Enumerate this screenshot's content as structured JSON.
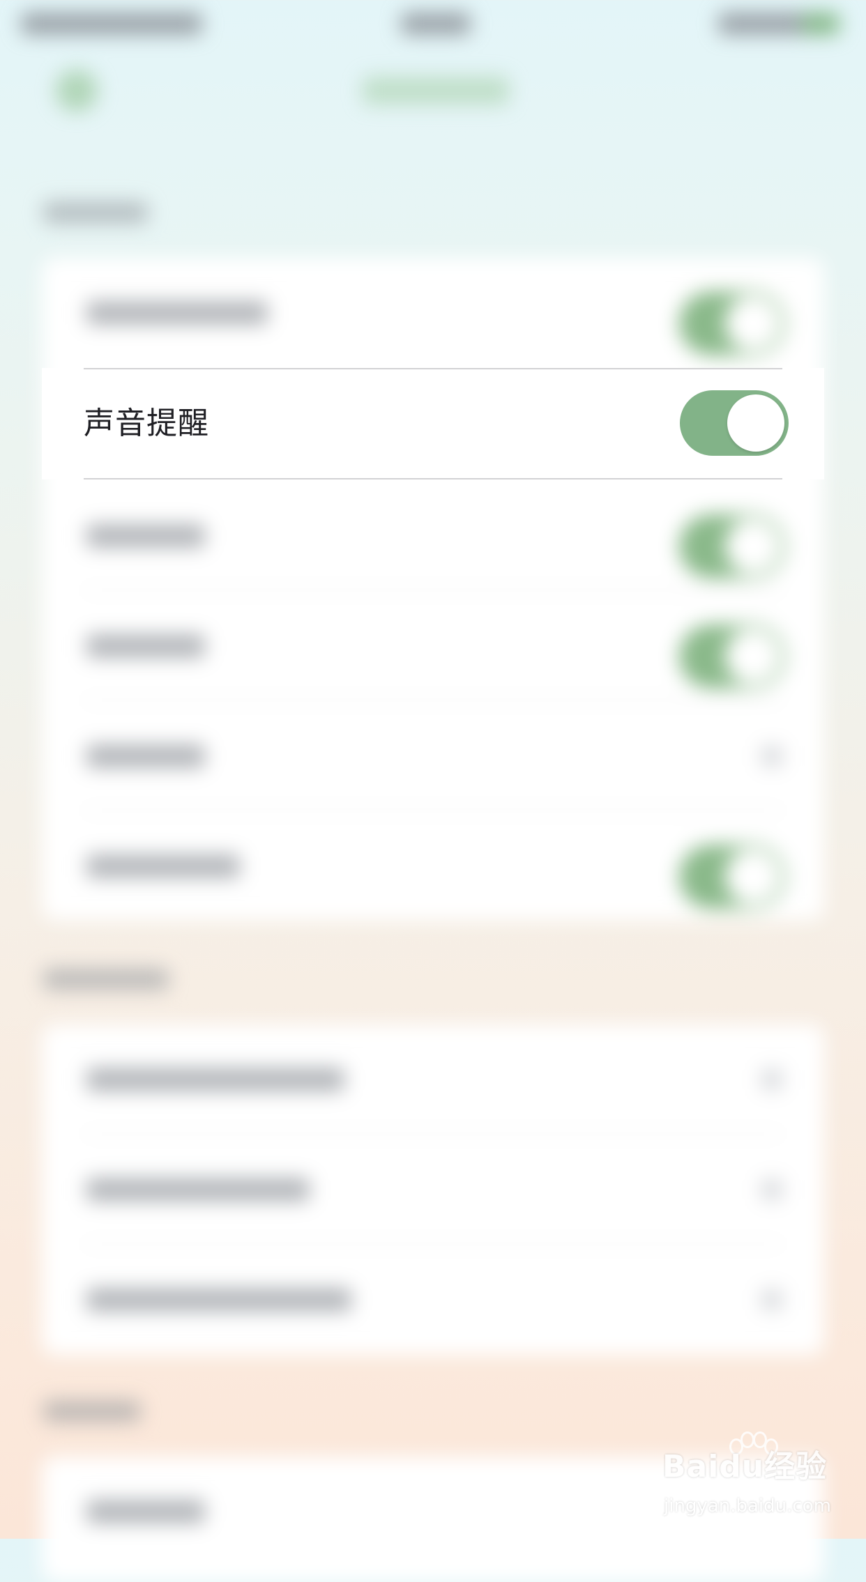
{
  "focused_row": {
    "label": "声音提醒",
    "toggle_state": "on"
  },
  "colors": {
    "toggle_on": "#82b388",
    "row_bg": "#ffffff",
    "label_text": "#1f1f24"
  },
  "watermark": {
    "logo_text": "Baidu经验",
    "url_text": "jingyan.baidu.com"
  }
}
